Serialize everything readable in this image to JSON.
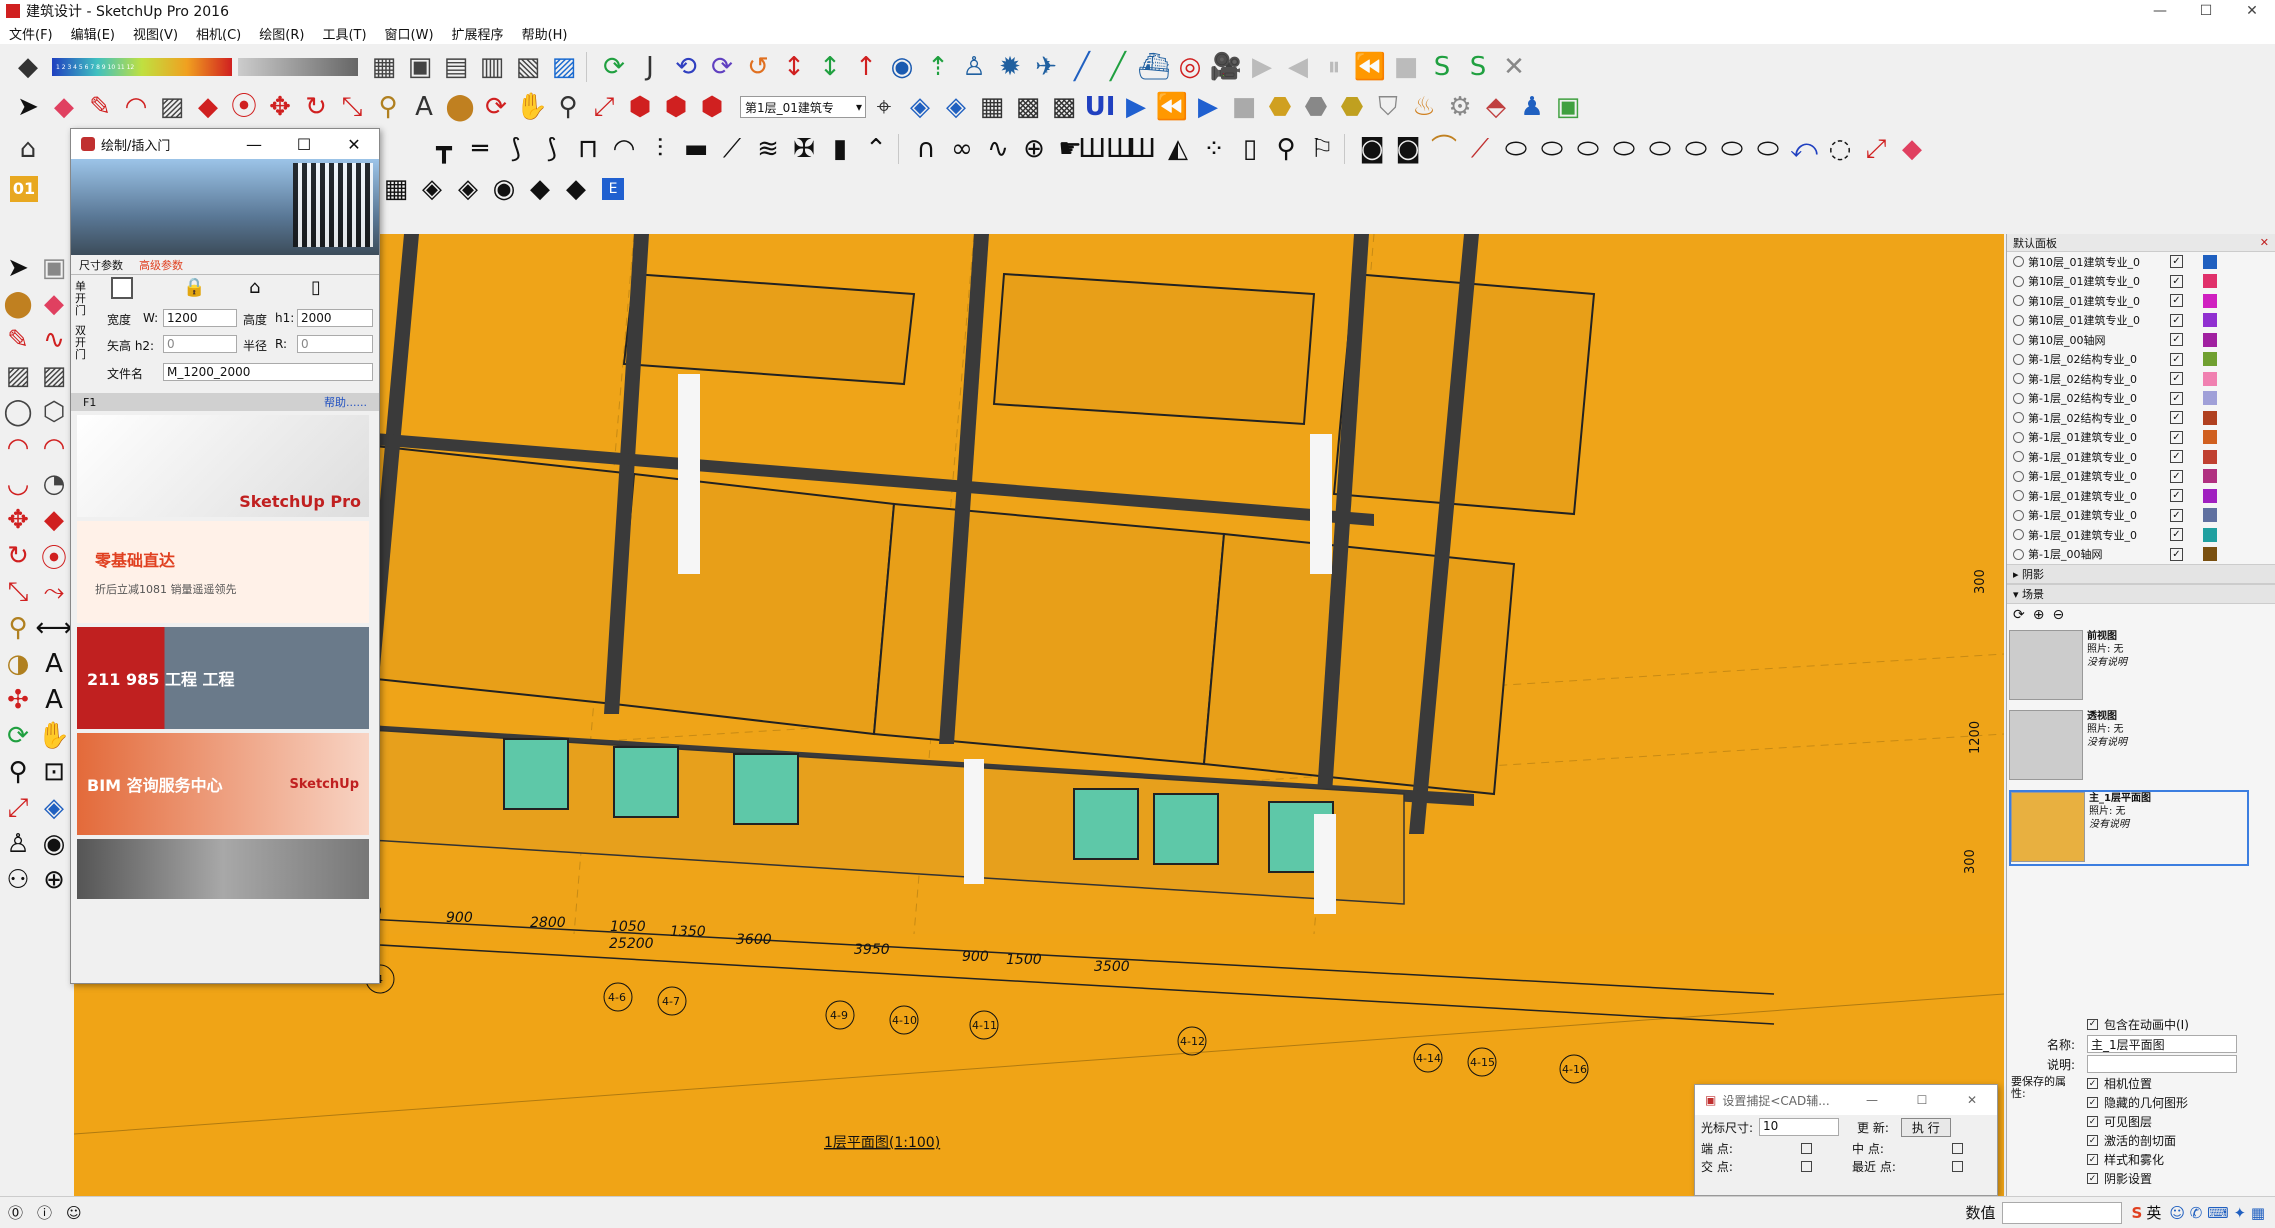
{
  "app": {
    "title": "建筑设计 - SketchUp Pro 2016"
  },
  "menu": [
    "文件(F)",
    "编辑(E)",
    "视图(V)",
    "相机(C)",
    "绘图(R)",
    "工具(T)",
    "窗口(W)",
    "扩展程序",
    "帮助(H)"
  ],
  "toolbar": {
    "layer_dropdown": "第1层_01建筑专",
    "ui_label": "UI",
    "style_badge": "01",
    "e_badge": "E",
    "color_scale": "1 2 3 4 5 6 7 8 9 10 11 12"
  },
  "plugin": {
    "title": "绘制/插入门",
    "tab_size": "尺寸参数",
    "tab_params": "高级参数",
    "single_label": "单开门",
    "double_label": "双开门",
    "width_label": "宽度",
    "w_label": "W:",
    "width_value": "1200",
    "height_label": "高度",
    "h1_label": "h1:",
    "height_value": "2000",
    "arc_label": "矢高 h2:",
    "arc_value": "0",
    "radius_label": "半径",
    "r_label": "R:",
    "radius_value": "0",
    "filename_label": "文件名",
    "filename_value": "M_1200_2000",
    "f1": "F1",
    "help": "帮助......",
    "ads": [
      {
        "text": "SketchUp Pro"
      },
      {
        "text": "零基础直达",
        "sub": "折后立减1081 销量遥遥领先"
      },
      {
        "text": "211 985 工程 工程"
      },
      {
        "text": "BIM 咨询服务中心",
        "sub": "SketchUp"
      },
      {
        "text": ""
      }
    ]
  },
  "tray": {
    "header": "默认面板",
    "tags": [
      {
        "name": "第10层_01建筑专业_0",
        "color": "#1f5fbf"
      },
      {
        "name": "第10层_01建筑专业_0",
        "color": "#e0306a"
      },
      {
        "name": "第10层_01建筑专业_0",
        "color": "#d020c0"
      },
      {
        "name": "第10层_01建筑专业_0",
        "color": "#9030d0"
      },
      {
        "name": "第10层_00轴网",
        "color": "#a020a0"
      },
      {
        "name": "第-1层_02结构专业_0",
        "color": "#70a030"
      },
      {
        "name": "第-1层_02结构专业_0",
        "color": "#f080b0"
      },
      {
        "name": "第-1层_02结构专业_0",
        "color": "#a0a0d8"
      },
      {
        "name": "第-1层_02结构专业_0",
        "color": "#b04020"
      },
      {
        "name": "第-1层_01建筑专业_0",
        "color": "#d06020"
      },
      {
        "name": "第-1层_01建筑专业_0",
        "color": "#c04030"
      },
      {
        "name": "第-1层_01建筑专业_0",
        "color": "#b03080"
      },
      {
        "name": "第-1层_01建筑专业_0",
        "color": "#a020c0"
      },
      {
        "name": "第-1层_01建筑专业_0",
        "color": "#6070a0"
      },
      {
        "name": "第-1层_01建筑专业_0",
        "color": "#20a0a0"
      },
      {
        "name": "第-1层_00轴网",
        "color": "#7a5010"
      }
    ],
    "shadow_section": "阴影",
    "scenes_section": "场景",
    "scenes": [
      {
        "name": "前视图",
        "photo": "照片: 无",
        "desc": "没有说明"
      },
      {
        "name": "透视图",
        "photo": "照片: 无",
        "desc": "没有说明"
      },
      {
        "name": "主_1层平面图",
        "photo": "照片: 无",
        "desc": "没有说明"
      }
    ],
    "include_anim": "包含在动画中(I)",
    "name_label": "名称:",
    "name_value": "主_1层平面图",
    "desc_label": "说明:",
    "save_props_label": "要保存的属性:",
    "props": [
      "相机位置",
      "隐藏的几何图形",
      "可见图层",
      "激活的剖切面",
      "样式和雾化",
      "阴影设置"
    ]
  },
  "dialog": {
    "title": "设置捕捉<CAD辅...",
    "cursor_label": "光标尺寸:",
    "cursor_value": "10",
    "update_label": "更  新:",
    "exec_label": "执 行",
    "endpoint": "端  点:",
    "midpoint": "中  点:",
    "intersect": "交  点:",
    "nearest": "最近 点:"
  },
  "drawing": {
    "dims": [
      "3950",
      "900",
      "2800",
      "1050",
      "1350",
      "3600",
      "3950",
      "900",
      "1500",
      "3500",
      "25200"
    ],
    "axes": [
      "4-6",
      "4-7",
      "4-9",
      "4-10",
      "4-11",
      "4-12",
      "4-14",
      "4-15",
      "4-16",
      "4"
    ],
    "vdims": [
      "300",
      "1200",
      "300"
    ],
    "plan_title": "1层平面图(1:100)"
  },
  "status": {
    "value_label": "数值",
    "ime": "英"
  }
}
